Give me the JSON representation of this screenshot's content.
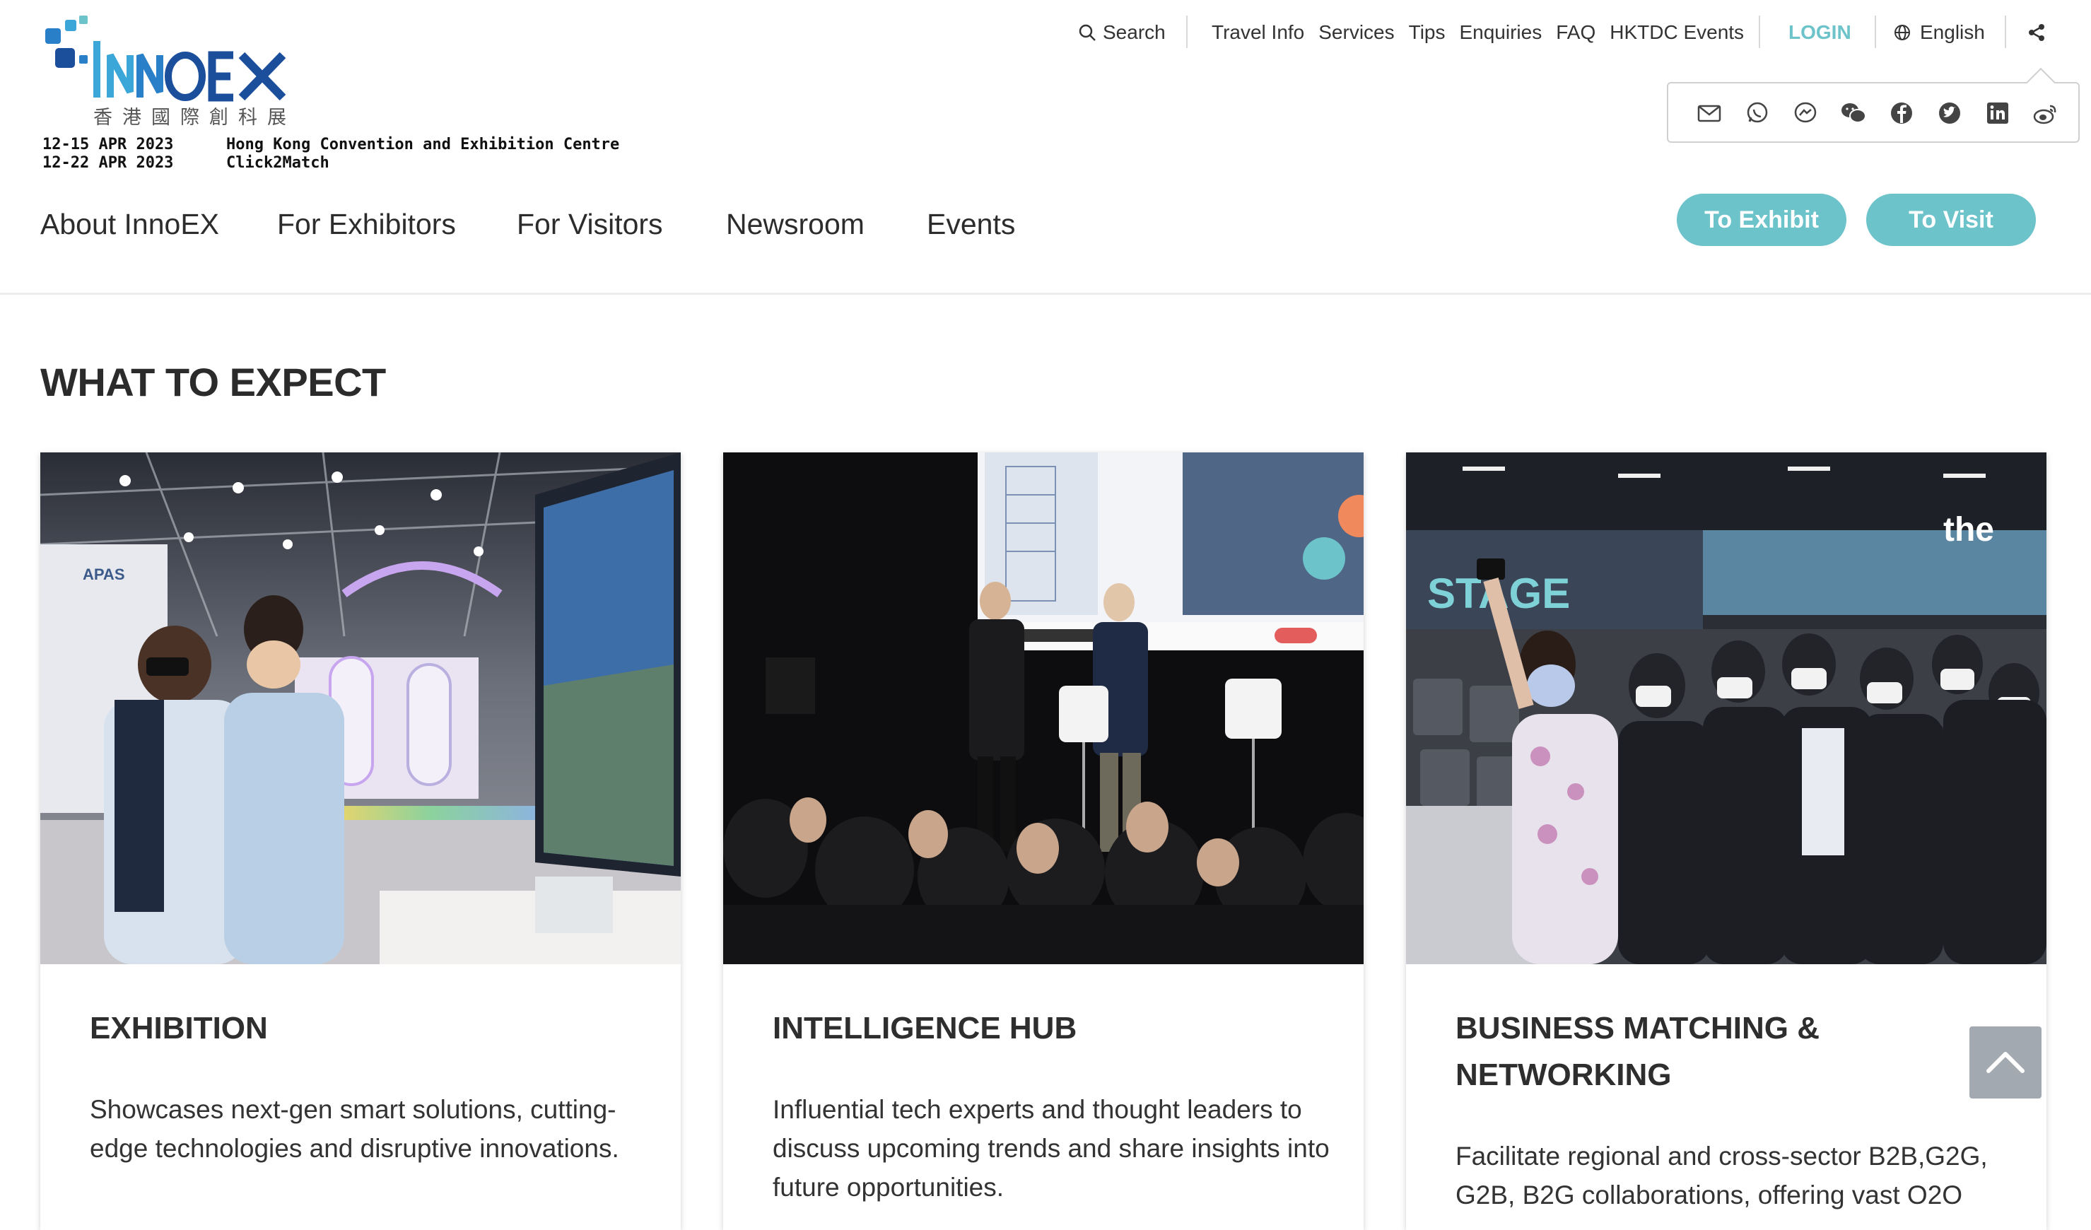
{
  "brand": {
    "logo_text": "INNOEX",
    "logo_chinese": "香港國際創科展",
    "dates": [
      "12-15 APR 2023",
      "12-22 APR 2023"
    ],
    "venues": [
      "Hong Kong Convention and Exhibition Centre",
      "Click2Match"
    ]
  },
  "topbar": {
    "search": "Search",
    "links": [
      "Travel Info",
      "Services",
      "Tips",
      "Enquiries",
      "FAQ",
      "HKTDC Events"
    ],
    "login": "LOGIN",
    "language": "English"
  },
  "share": {
    "icons": [
      "email-icon",
      "whatsapp-icon",
      "messenger-icon",
      "wechat-icon",
      "facebook-icon",
      "twitter-icon",
      "linkedin-icon",
      "weibo-icon"
    ]
  },
  "nav": {
    "items": [
      "About InnoEX",
      "For Exhibitors",
      "For Visitors",
      "Newsroom",
      "Events"
    ],
    "exhibit_button": "To Exhibit",
    "visit_button": "To Visit"
  },
  "section": {
    "title": "WHAT TO EXPECT"
  },
  "cards": [
    {
      "title": "EXHIBITION",
      "text": "Showcases next-gen smart solutions, cutting-edge technologies and disruptive innovations."
    },
    {
      "title": "INTELLIGENCE HUB",
      "text": "Influential tech experts and thought leaders to discuss upcoming trends and share insights into future opportunities."
    },
    {
      "title": "BUSINESS MATCHING & NETWORKING",
      "text": "Facilitate regional and cross-sector B2B,G2G, G2B, B2G collaborations, offering vast O2O"
    }
  ],
  "colors": {
    "accent": "#6cc3c9",
    "text": "#333333",
    "login": "#6cc3c9",
    "back_to_top": "#a3a9b0"
  }
}
